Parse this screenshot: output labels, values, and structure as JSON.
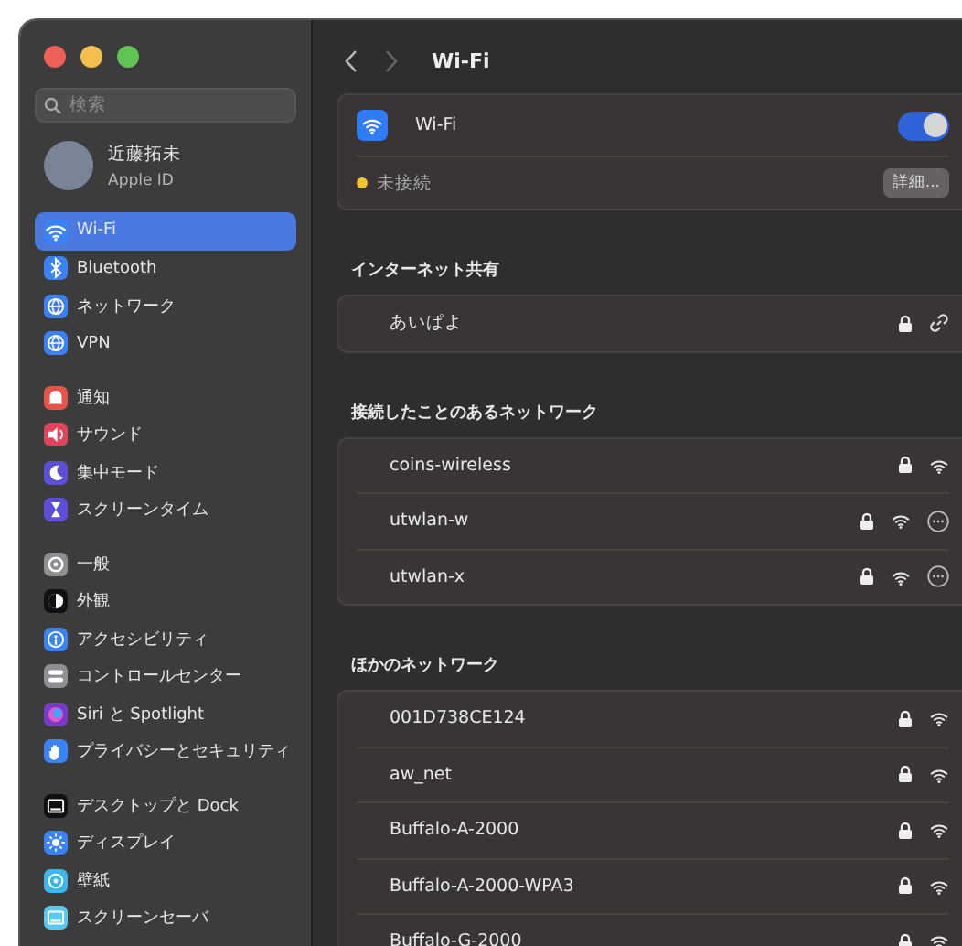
{
  "sidebar": {
    "search": {
      "placeholder": "検索"
    },
    "account": {
      "name": "近藤拓未",
      "subtitle": "Apple ID"
    },
    "groups": [
      [
        {
          "label": "Wi-Fi",
          "kind": "wifi",
          "color": "#3b82f6",
          "selected": true
        },
        {
          "label": "Bluetooth",
          "kind": "bluetooth",
          "color": "#3b82f6",
          "selected": false
        },
        {
          "label": "ネットワーク",
          "kind": "globe",
          "color": "#3b82f6",
          "selected": false
        },
        {
          "label": "VPN",
          "kind": "globe",
          "color": "#3b82f6",
          "selected": false
        }
      ],
      [
        {
          "label": "通知",
          "kind": "bell",
          "color": "#e5534b",
          "selected": false
        },
        {
          "label": "サウンド",
          "kind": "speaker",
          "color": "#e0445a",
          "selected": false
        },
        {
          "label": "集中モード",
          "kind": "moon",
          "color": "#5b4fd6",
          "selected": false
        },
        {
          "label": "スクリーンタイム",
          "kind": "hourglass",
          "color": "#5e4fd8",
          "selected": false
        }
      ],
      [
        {
          "label": "一般",
          "kind": "gear",
          "color": "#8e8e93",
          "selected": false
        },
        {
          "label": "外観",
          "kind": "circle",
          "color": "#111111",
          "selected": false
        },
        {
          "label": "アクセシビリティ",
          "kind": "person",
          "color": "#3b82f6",
          "selected": false
        },
        {
          "label": "コントロールセンター",
          "kind": "toggles",
          "color": "#8e8e93",
          "selected": false
        },
        {
          "label": "Siri と Spotlight",
          "kind": "orb",
          "color": "#7a3ac8",
          "selected": false
        },
        {
          "label": "プライバシーとセキュリティ",
          "kind": "hand",
          "color": "#3b82f6",
          "selected": false
        }
      ],
      [
        {
          "label": "デスクトップと Dock",
          "kind": "display",
          "color": "#111111",
          "selected": false
        },
        {
          "label": "ディスプレイ",
          "kind": "sun",
          "color": "#3b82f6",
          "selected": false
        },
        {
          "label": "壁紙",
          "kind": "flower",
          "color": "#3fb6e8",
          "selected": false
        },
        {
          "label": "スクリーンセーバ",
          "kind": "display",
          "color": "#5ac8f0",
          "selected": false
        }
      ]
    ]
  },
  "pane": {
    "title": "Wi-Fi",
    "wifi": {
      "label": "Wi-Fi",
      "on": true,
      "status": "未接続",
      "connected": false,
      "details_button": "詳細..."
    },
    "sections": [
      {
        "title": "インターネット共有",
        "networks": [
          {
            "name": "あいぱよ",
            "kind": "hotspot",
            "locked": true,
            "more": false
          }
        ]
      },
      {
        "title": "接続したことのあるネットワーク",
        "networks": [
          {
            "name": "coins-wireless",
            "kind": "network",
            "locked": true,
            "more": false
          },
          {
            "name": "utwlan-w",
            "kind": "network",
            "locked": true,
            "more": true
          },
          {
            "name": "utwlan-x",
            "kind": "network",
            "locked": true,
            "more": true
          }
        ]
      },
      {
        "title": "ほかのネットワーク",
        "networks": [
          {
            "name": "001D738CE124",
            "kind": "network",
            "locked": true,
            "more": false
          },
          {
            "name": "aw_net",
            "kind": "network",
            "locked": true,
            "more": false
          },
          {
            "name": "Buffalo-A-2000",
            "kind": "network",
            "locked": true,
            "more": false
          },
          {
            "name": "Buffalo-A-2000-WPA3",
            "kind": "network",
            "locked": true,
            "more": false
          },
          {
            "name": "Buffalo-G-2000",
            "kind": "network",
            "locked": true,
            "more": false
          }
        ]
      }
    ]
  }
}
